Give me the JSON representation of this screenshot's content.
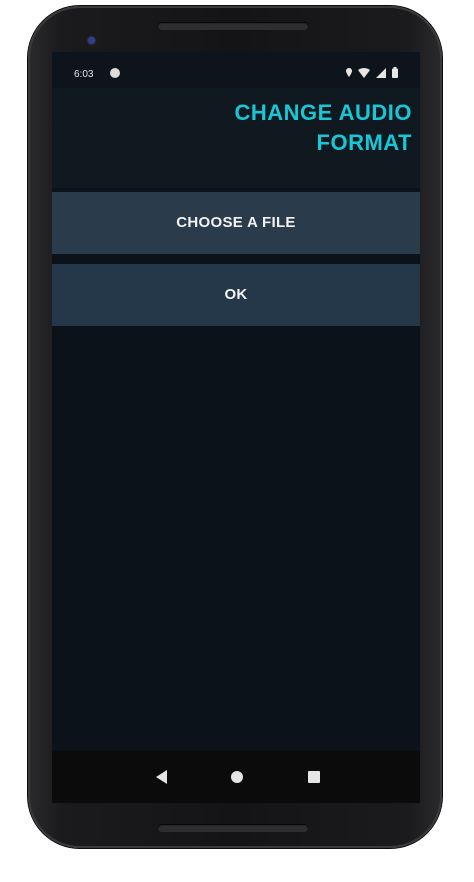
{
  "status_bar": {
    "time": "6:03",
    "icons": [
      "notification-dot-icon",
      "wifi-icon",
      "signal-icon",
      "battery-icon"
    ]
  },
  "app": {
    "title_line1": "CHANGE AUDIO",
    "title_line2": "FORMAT",
    "accent_color": "#19c6d6"
  },
  "buttons": {
    "choose_file": "CHOOSE A FILE",
    "ok": "OK"
  },
  "nav_bar": {
    "icons": [
      "back-icon",
      "home-icon",
      "recents-icon"
    ]
  }
}
